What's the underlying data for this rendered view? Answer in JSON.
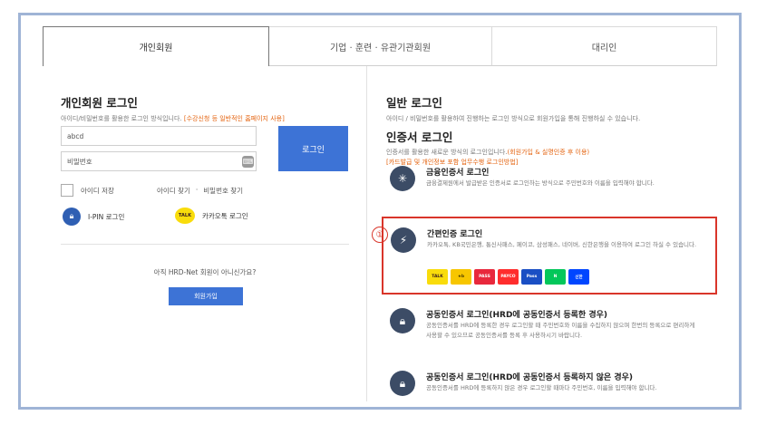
{
  "tabs": [
    {
      "label": "개인회원",
      "active": true
    },
    {
      "label": "기업 · 훈련 · 유관기관회원",
      "active": false
    },
    {
      "label": "대리인",
      "active": false
    }
  ],
  "left": {
    "title": "개인회원 로그인",
    "subtitle": "아이디/비밀번호를 활용한 로그인 방식입니다.",
    "subtitle_warn": "[수강신청 등 일반적인 홈페이지 사용]",
    "id_value": "abcd",
    "pw_placeholder": "비밀번호",
    "login_button": "로그인",
    "save_id": "아이디 저장",
    "find_id": "아이디 찾기",
    "find_sep": "·",
    "find_pw": "비밀번호 찾기",
    "ipin_label": "I-PIN 로그인",
    "ipin_icon": "lock-icon",
    "kakao_label": "카카오톡 로그인",
    "kakao_icon_text": "TALK",
    "not_member": "아직 HRD-Net 회원이 아니신가요?",
    "join_button": "회원가입"
  },
  "right": {
    "title": "일반 로그인",
    "subtitle": "아이디 / 비밀번호를 활용하여 진행하는 로그인 방식으로 회원가입을 통해 진행하실 수 있습니다.",
    "cert_title": "인증서 로그인",
    "cert_sub1": "인증서를 활용한 새로운 방식의 로그인입니다.",
    "cert_sub1_warn": "(회원가입 & 실명인증 후 이용)",
    "cert_sub2": "[카드발급 및 개인정보 포함 업무수행 로그인방법]",
    "sections": {
      "financial": {
        "title": "금융인증서 로그인",
        "desc": "금융결제원에서 발급받은 인증서로 로그인하는 방식으로 주민번호와 이름을 입력해야 합니다."
      },
      "simple": {
        "title": "간편인증 로그인",
        "desc": "카카오톡, KB국민은행, 통신사패스, 페이코, 삼성패스, 네이버, 신한은행을 이용하여 로그인 하실 수 있습니다."
      },
      "joint1": {
        "title": "공동인증서 로그인(HRD에 공동인증서 등록한 경우)",
        "desc": "공동인증서를 HRD에 등록한 경우 로그인할 때 주민번호와 이름을 수집하지 않으며 한번의 등록으로 편리하게 사용할 수 있으므로 공동인증서를 등록 후 사용하시기 바랍니다."
      },
      "joint2": {
        "title": "공동인증서 로그인(HRD에 공동인증서 등록하지 않은 경우)",
        "desc": "공동인증서를 HRD에 등록하지 않은 경우 로그인할 때마다 주민번호, 이름을 입력해야 합니다."
      }
    },
    "annotation_number": "①",
    "providers": [
      {
        "text": "TALK",
        "bg": "#f9dc0b",
        "fg": "#3a1d1d"
      },
      {
        "text": "★b",
        "bg": "#f7c600",
        "fg": "#4a3b00"
      },
      {
        "text": "PASS",
        "bg": "#e8283c",
        "fg": "#ffffff"
      },
      {
        "text": "PAYCO",
        "bg": "#ff2d2d",
        "fg": "#ffffff"
      },
      {
        "text": "Pass",
        "bg": "#1a4fc4",
        "fg": "#ffffff"
      },
      {
        "text": "N",
        "bg": "#03c75a",
        "fg": "#ffffff"
      },
      {
        "text": "신한",
        "bg": "#0046ff",
        "fg": "#ffffff"
      }
    ]
  }
}
